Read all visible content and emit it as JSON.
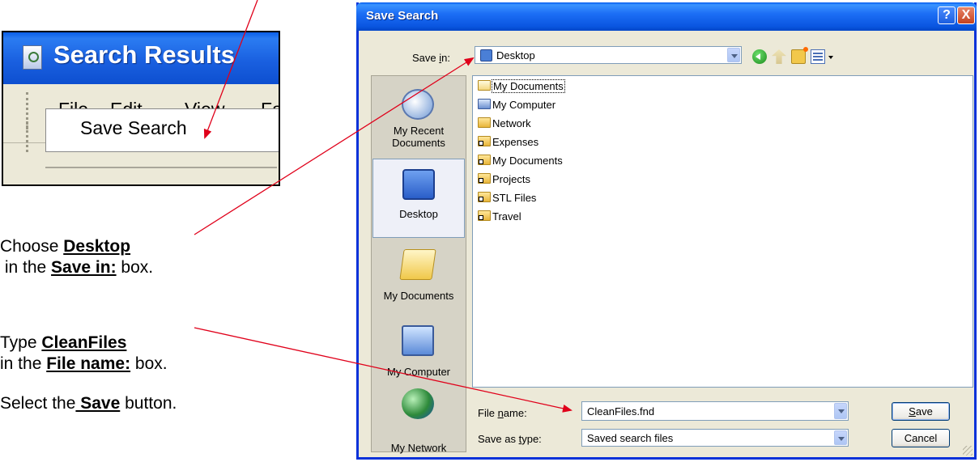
{
  "inset": {
    "title": "Search Results",
    "menu": [
      "File",
      "Edit",
      "View",
      "Fa"
    ],
    "dropdown_item": "Save Search"
  },
  "instructions": {
    "step1": {
      "pre": "Choose ",
      "bold": "Desktop",
      "line2_pre": " in the ",
      "line2_bold": "Save in:",
      "line2_post": " box."
    },
    "step2": {
      "pre": "Type ",
      "bold": "CleanFiles",
      "line2_pre": "in the ",
      "line2_bold": "File name:",
      "line2_post": " box."
    },
    "step3": {
      "pre": "Select the",
      "bold": " Save",
      "post": " button."
    }
  },
  "dialog": {
    "title": "Save Search",
    "help_glyph": "?",
    "close_glyph": "X",
    "save_in": {
      "label_pre": "Save ",
      "label_u": "i",
      "label_post": "n:",
      "value": "Desktop"
    },
    "places": [
      {
        "label_l1": "My Recent",
        "label_l2": "Documents",
        "icon": "recent-documents-icon"
      },
      {
        "label_l1": "Desktop",
        "label_l2": "",
        "icon": "desktop-icon"
      },
      {
        "label_l1": "My Documents",
        "label_l2": "",
        "icon": "my-documents-icon"
      },
      {
        "label_l1": "My Computer",
        "label_l2": "",
        "icon": "my-computer-icon"
      },
      {
        "label_l1": "My Network",
        "label_l2": "",
        "icon": "my-network-icon"
      }
    ],
    "files": [
      {
        "name": "My Documents",
        "icon": "documents-folder-icon"
      },
      {
        "name": "My Computer",
        "icon": "computer-icon"
      },
      {
        "name": "Network",
        "icon": "folder-icon"
      },
      {
        "name": "Expenses",
        "icon": "shortcut-folder-icon"
      },
      {
        "name": "My Documents",
        "icon": "shortcut-folder-icon"
      },
      {
        "name": "Projects",
        "icon": "shortcut-folder-icon"
      },
      {
        "name": "STL Files",
        "icon": "shortcut-folder-icon"
      },
      {
        "name": "Travel",
        "icon": "shortcut-folder-icon"
      }
    ],
    "file_name": {
      "label_pre": "File ",
      "label_u": "n",
      "label_post": "ame:",
      "value": "CleanFiles.fnd"
    },
    "save_as_type": {
      "label_pre": "Save as ",
      "label_u": "t",
      "label_post": "ype:",
      "value": "Saved search files"
    },
    "save_button": {
      "u": "S",
      "rest": "ave"
    },
    "cancel_button": "Cancel"
  },
  "annotation_color": "#e0001a"
}
